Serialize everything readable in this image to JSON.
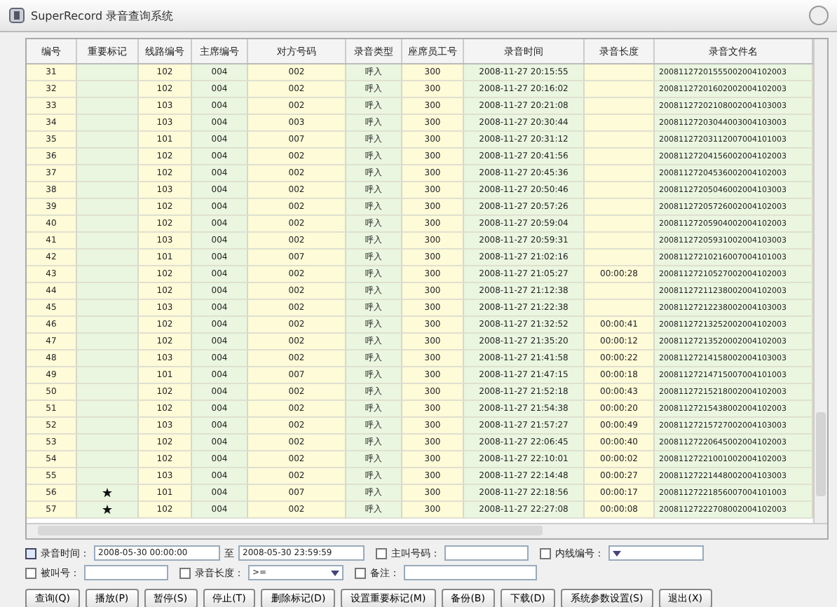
{
  "window": {
    "title": "SuperRecord 录音查询系统"
  },
  "table": {
    "columns": [
      "编号",
      "重要标记",
      "线路编号",
      "主席编号",
      "对方号码",
      "录音类型",
      "座席员工号",
      "录音时间",
      "录音长度",
      "录音文件名"
    ],
    "rows": [
      {
        "important": false,
        "cells": [
          "31",
          "",
          "102",
          "004",
          "002",
          "呼入",
          "300",
          "2008-11-27 20:15:55",
          "",
          "20081127201555002004102003"
        ]
      },
      {
        "important": false,
        "cells": [
          "32",
          "",
          "102",
          "004",
          "002",
          "呼入",
          "300",
          "2008-11-27 20:16:02",
          "",
          "20081127201602002004102003"
        ]
      },
      {
        "important": false,
        "cells": [
          "33",
          "",
          "103",
          "004",
          "002",
          "呼入",
          "300",
          "2008-11-27 20:21:08",
          "",
          "20081127202108002004103003"
        ]
      },
      {
        "important": false,
        "cells": [
          "34",
          "",
          "103",
          "004",
          "003",
          "呼入",
          "300",
          "2008-11-27 20:30:44",
          "",
          "20081127203044003004103003"
        ]
      },
      {
        "important": false,
        "cells": [
          "35",
          "",
          "101",
          "004",
          "007",
          "呼入",
          "300",
          "2008-11-27 20:31:12",
          "",
          "20081127203112007004101003"
        ]
      },
      {
        "important": false,
        "cells": [
          "36",
          "",
          "102",
          "004",
          "002",
          "呼入",
          "300",
          "2008-11-27 20:41:56",
          "",
          "20081127204156002004102003"
        ]
      },
      {
        "important": false,
        "cells": [
          "37",
          "",
          "102",
          "004",
          "002",
          "呼入",
          "300",
          "2008-11-27 20:45:36",
          "",
          "20081127204536002004102003"
        ]
      },
      {
        "important": false,
        "cells": [
          "38",
          "",
          "103",
          "004",
          "002",
          "呼入",
          "300",
          "2008-11-27 20:50:46",
          "",
          "20081127205046002004103003"
        ]
      },
      {
        "important": false,
        "cells": [
          "39",
          "",
          "102",
          "004",
          "002",
          "呼入",
          "300",
          "2008-11-27 20:57:26",
          "",
          "20081127205726002004102003"
        ]
      },
      {
        "important": false,
        "cells": [
          "40",
          "",
          "102",
          "004",
          "002",
          "呼入",
          "300",
          "2008-11-27 20:59:04",
          "",
          "20081127205904002004102003"
        ]
      },
      {
        "important": false,
        "cells": [
          "41",
          "",
          "103",
          "004",
          "002",
          "呼入",
          "300",
          "2008-11-27 20:59:31",
          "",
          "20081127205931002004103003"
        ]
      },
      {
        "important": false,
        "cells": [
          "42",
          "",
          "101",
          "004",
          "007",
          "呼入",
          "300",
          "2008-11-27 21:02:16",
          "",
          "20081127210216007004101003"
        ]
      },
      {
        "important": false,
        "cells": [
          "43",
          "",
          "102",
          "004",
          "002",
          "呼入",
          "300",
          "2008-11-27 21:05:27",
          "00:00:28",
          "20081127210527002004102003"
        ]
      },
      {
        "important": false,
        "cells": [
          "44",
          "",
          "102",
          "004",
          "002",
          "呼入",
          "300",
          "2008-11-27 21:12:38",
          "",
          "20081127211238002004102003"
        ]
      },
      {
        "important": false,
        "cells": [
          "45",
          "",
          "103",
          "004",
          "002",
          "呼入",
          "300",
          "2008-11-27 21:22:38",
          "",
          "20081127212238002004103003"
        ]
      },
      {
        "important": false,
        "cells": [
          "46",
          "",
          "102",
          "004",
          "002",
          "呼入",
          "300",
          "2008-11-27 21:32:52",
          "00:00:41",
          "20081127213252002004102003"
        ]
      },
      {
        "important": false,
        "cells": [
          "47",
          "",
          "102",
          "004",
          "002",
          "呼入",
          "300",
          "2008-11-27 21:35:20",
          "00:00:12",
          "20081127213520002004102003"
        ]
      },
      {
        "important": false,
        "cells": [
          "48",
          "",
          "103",
          "004",
          "002",
          "呼入",
          "300",
          "2008-11-27 21:41:58",
          "00:00:22",
          "20081127214158002004103003"
        ]
      },
      {
        "important": false,
        "cells": [
          "49",
          "",
          "101",
          "004",
          "007",
          "呼入",
          "300",
          "2008-11-27 21:47:15",
          "00:00:18",
          "20081127214715007004101003"
        ]
      },
      {
        "important": false,
        "cells": [
          "50",
          "",
          "102",
          "004",
          "002",
          "呼入",
          "300",
          "2008-11-27 21:52:18",
          "00:00:43",
          "20081127215218002004102003"
        ]
      },
      {
        "important": false,
        "cells": [
          "51",
          "",
          "102",
          "004",
          "002",
          "呼入",
          "300",
          "2008-11-27 21:54:38",
          "00:00:20",
          "20081127215438002004102003"
        ]
      },
      {
        "important": false,
        "cells": [
          "52",
          "",
          "103",
          "004",
          "002",
          "呼入",
          "300",
          "2008-11-27 21:57:27",
          "00:00:49",
          "20081127215727002004103003"
        ]
      },
      {
        "important": false,
        "cells": [
          "53",
          "",
          "102",
          "004",
          "002",
          "呼入",
          "300",
          "2008-11-27 22:06:45",
          "00:00:40",
          "20081127220645002004102003"
        ]
      },
      {
        "important": false,
        "cells": [
          "54",
          "",
          "102",
          "004",
          "002",
          "呼入",
          "300",
          "2008-11-27 22:10:01",
          "00:00:02",
          "20081127221001002004102003"
        ]
      },
      {
        "important": false,
        "cells": [
          "55",
          "",
          "103",
          "004",
          "002",
          "呼入",
          "300",
          "2008-11-27 22:14:48",
          "00:00:27",
          "20081127221448002004103003"
        ]
      },
      {
        "important": true,
        "cells": [
          "56",
          "",
          "101",
          "004",
          "007",
          "呼入",
          "300",
          "2008-11-27 22:18:56",
          "00:00:17",
          "20081127221856007004101003"
        ]
      },
      {
        "important": true,
        "cells": [
          "57",
          "",
          "102",
          "004",
          "002",
          "呼入",
          "300",
          "2008-11-27 22:27:08",
          "00:00:08",
          "20081127222708002004102003"
        ]
      }
    ]
  },
  "filters": [
    {
      "kind": "datetime",
      "checked": true,
      "label": "录音时间：",
      "from": "2008-05-30 00:00:00",
      "sep": "至",
      "to": "2008-05-30 23:59:59"
    },
    {
      "kind": "text",
      "checked": false,
      "label": "主叫号码："
    },
    {
      "kind": "combo",
      "checked": false,
      "label": "内线编号："
    },
    {
      "kind": "text",
      "checked": false,
      "label": "被叫号："
    },
    {
      "kind": "combo",
      "checked": false,
      "label": "录音长度：",
      "value": ">="
    },
    {
      "kind": "text",
      "checked": false,
      "label": "备注："
    }
  ],
  "buttons": [
    "查询(Q)",
    "播放(P)",
    "暂停(S)",
    "停止(T)",
    "删除标记(D)",
    "设置重要标记(M)",
    "备份(B)",
    "下载(D)",
    "系统参数设置(S)",
    "退出(X)"
  ]
}
